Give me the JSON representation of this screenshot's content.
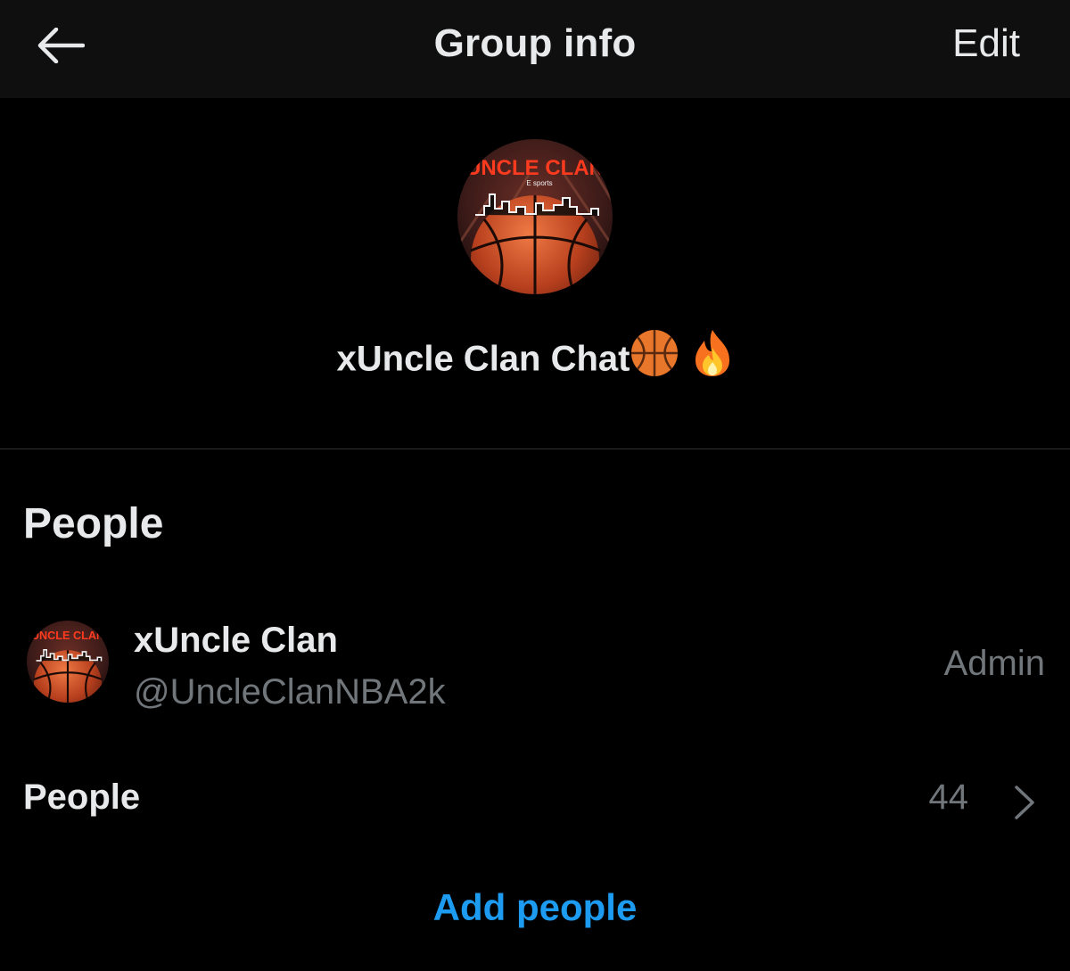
{
  "header": {
    "back_icon": "arrow-left-icon",
    "title": "Group info",
    "edit_label": "Edit"
  },
  "group": {
    "avatar_icon": "group-avatar-basketball-logo",
    "avatar_logo_text": "UNCLE CLAN",
    "avatar_logo_subtext": "E sports",
    "name": "xUncle Clan Chat",
    "name_emojis": [
      "basketball-emoji",
      "fire-emoji"
    ]
  },
  "people_section": {
    "title": "People",
    "members": [
      {
        "name": "xUncle Clan",
        "handle": "@UncleClanNBA2k",
        "role": "Admin",
        "avatar_icon": "member-avatar-basketball-logo"
      }
    ],
    "people_row": {
      "label": "People",
      "count": "44",
      "chevron_icon": "chevron-right-icon"
    },
    "add_people_label": "Add people"
  },
  "colors": {
    "background": "#000000",
    "header_background": "#0f0f0f",
    "primary_text": "#e7e9ea",
    "secondary_text": "#71767b",
    "accent": "#1d9bf0",
    "divider": "#2f3336"
  }
}
